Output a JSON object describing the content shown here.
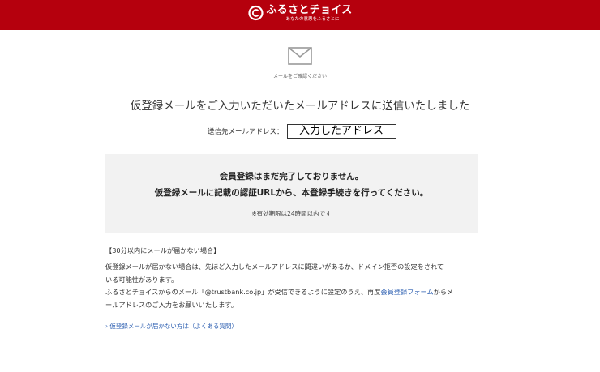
{
  "header": {
    "brand": "ふるさとチョイス",
    "tagline": "あなたの意思をふるさとに",
    "color": "#b5000d"
  },
  "mail_icon": {
    "icon": "envelope-icon",
    "caption": "メールをご確認ください"
  },
  "main_message": "仮登録メールをご入力いただいたメールアドレスに送信いたしました",
  "destination": {
    "label": "送信先メールアドレス：",
    "value": "入力したアドレス"
  },
  "notice": {
    "line1": "会員登録はまだ完了しておりません。",
    "line2": "仮登録メールに記載の認証URLから、本登録手続きを行ってください。",
    "note": "※有効期限は24時間以内です"
  },
  "faq": {
    "heading": "【30分以内にメールが届かない場合】",
    "p1_line1": "仮登録メールが届かない場合は、先ほど入力したメールアドレスに間違いがあるか、ドメイン拒否の設定をされて",
    "p1_line2": "いる可能性があります。",
    "p2_part1": "ふるさとチョイスからのメール「@trustbank.co.jp」が受信できるように設定のうえ、再度",
    "p2_link": "会員登録フォーム",
    "p2_part2": "からメ",
    "p2_line2": "ールアドレスのご入力をお願いいたします。",
    "link_color": "#2a5db0"
  },
  "help_link": "› 仮登録メールが届かない方は（よくある質問）"
}
